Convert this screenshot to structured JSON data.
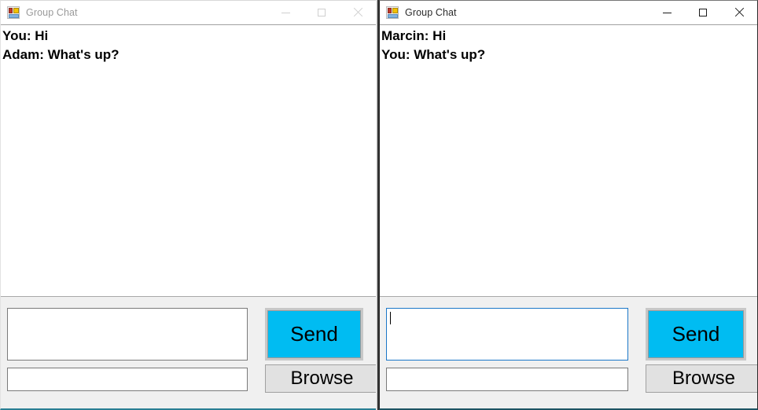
{
  "windows": [
    {
      "id": "left",
      "state": "inactive",
      "title": "Group Chat",
      "icon": "winforms-app-icon",
      "caption_buttons": [
        {
          "name": "minimize",
          "glyph": "minimize-icon"
        },
        {
          "name": "maximize",
          "glyph": "maximize-icon"
        },
        {
          "name": "close",
          "glyph": "close-icon"
        }
      ],
      "chat": {
        "messages": [
          "You: Hi",
          "Adam: What's up?"
        ]
      },
      "message_input": {
        "value": "",
        "placeholder": "",
        "focused": false
      },
      "file_input": {
        "value": "",
        "placeholder": "",
        "focused": false
      },
      "send_button": {
        "label": "Send",
        "color": "#00bcf2"
      },
      "browse_button": {
        "label": "Browse",
        "color": "#e1e1e1"
      }
    },
    {
      "id": "right",
      "state": "active",
      "title": "Group Chat",
      "icon": "winforms-app-icon",
      "caption_buttons": [
        {
          "name": "minimize",
          "glyph": "minimize-icon"
        },
        {
          "name": "maximize",
          "glyph": "maximize-icon"
        },
        {
          "name": "close",
          "glyph": "close-icon"
        }
      ],
      "chat": {
        "messages": [
          "Marcin: Hi",
          "You: What's up?"
        ]
      },
      "message_input": {
        "value": "",
        "placeholder": "",
        "focused": true
      },
      "file_input": {
        "value": "",
        "placeholder": "",
        "focused": false
      },
      "send_button": {
        "label": "Send",
        "color": "#00bcf2"
      },
      "browse_button": {
        "label": "Browse",
        "color": "#e1e1e1"
      }
    }
  ],
  "theme": {
    "accent_send": "#00bcf2",
    "focus_border": "#1b77c8",
    "window_bottom_accent_left": "#2a7f94",
    "window_bottom_accent_right": "#1d5464",
    "panel_background": "#f0f0f0",
    "chat_background": "#ffffff"
  }
}
